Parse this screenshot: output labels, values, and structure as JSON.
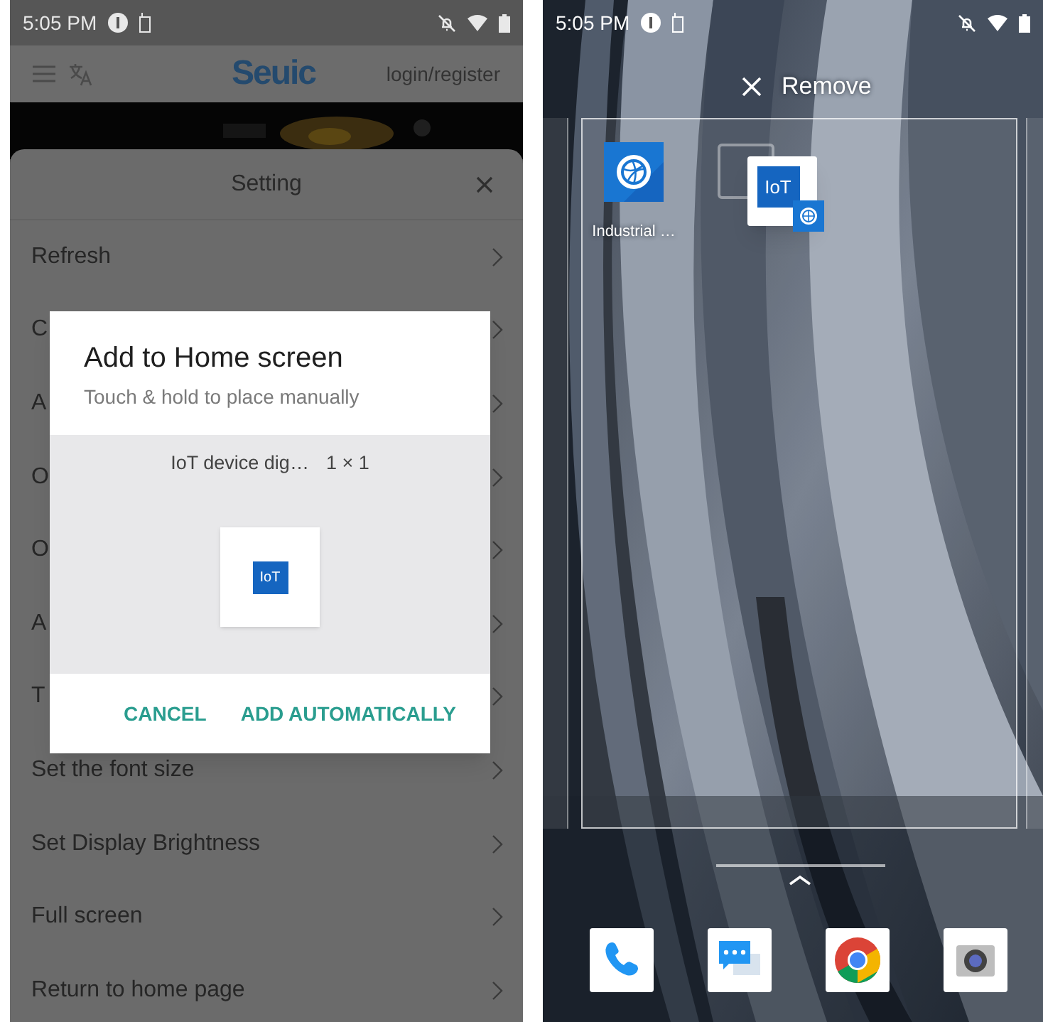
{
  "left_screen": {
    "status_bar": {
      "time": "5:05 PM"
    },
    "app_bar": {
      "logo": "Seuic",
      "login_link": "login/register"
    },
    "setting_sheet": {
      "title": "Setting",
      "items": [
        {
          "label": "Refresh"
        },
        {
          "label": "C"
        },
        {
          "label": "A"
        },
        {
          "label": "O"
        },
        {
          "label": "O"
        },
        {
          "label": "A"
        },
        {
          "label": "T"
        },
        {
          "label": "Set the font size"
        },
        {
          "label": "Set Display Brightness"
        },
        {
          "label": "Full screen"
        },
        {
          "label": "Return to home page"
        }
      ]
    },
    "dialog": {
      "title": "Add to Home screen",
      "subtitle": "Touch & hold to place manually",
      "widget_name": "IoT device dig…",
      "widget_size": "1 × 1",
      "widget_icon_label": "IoT",
      "buttons": [
        "CANCEL",
        "ADD AUTOMATICALLY"
      ]
    }
  },
  "right_screen": {
    "status_bar": {
      "time": "5:05 PM"
    },
    "remove_label": "Remove",
    "apps": [
      {
        "label": "Industrial …"
      }
    ],
    "drag_icon_label": "IoT",
    "dock": [
      {
        "kind": "phone"
      },
      {
        "kind": "messages"
      },
      {
        "kind": "browser"
      },
      {
        "kind": "camera"
      }
    ]
  }
}
